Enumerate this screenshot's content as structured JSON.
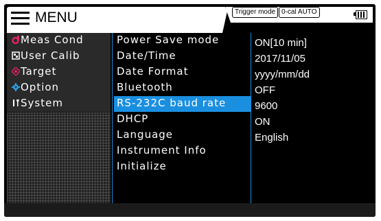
{
  "header": {
    "menu_label": "MENU",
    "trigger_badge": "Trigger mode",
    "cal_badge": "0-cal AUTO",
    "battery_icon": "battery-icon"
  },
  "sidebar": {
    "items": [
      {
        "label": "Meas Cond",
        "icon": "meas-cond-icon",
        "color": "#e0245e"
      },
      {
        "label": "User Calib",
        "icon": "user-calib-icon",
        "color": "#ffffff"
      },
      {
        "label": "Target",
        "icon": "target-icon",
        "color": "#e0245e"
      },
      {
        "label": "Option",
        "icon": "gear-icon",
        "color": "#2aa0e8"
      },
      {
        "label": "System",
        "icon": "tools-icon",
        "color": "#ffffff"
      }
    ]
  },
  "options": [
    {
      "label": "Power Save mode",
      "value": "ON[10 min]"
    },
    {
      "label": "Date/Time",
      "value": "2017/11/05"
    },
    {
      "label": "Date Format",
      "value": "yyyy/mm/dd"
    },
    {
      "label": "Bluetooth",
      "value": "OFF"
    },
    {
      "label": "RS-232C baud rate",
      "value": "9600",
      "selected": true
    },
    {
      "label": "DHCP",
      "value": "ON"
    },
    {
      "label": "Language",
      "value": "English"
    },
    {
      "label": "Instrument Info",
      "value": ""
    },
    {
      "label": "Initialize",
      "value": ""
    }
  ],
  "colors": {
    "accent": "#1a8fe0",
    "background": "#000000"
  }
}
